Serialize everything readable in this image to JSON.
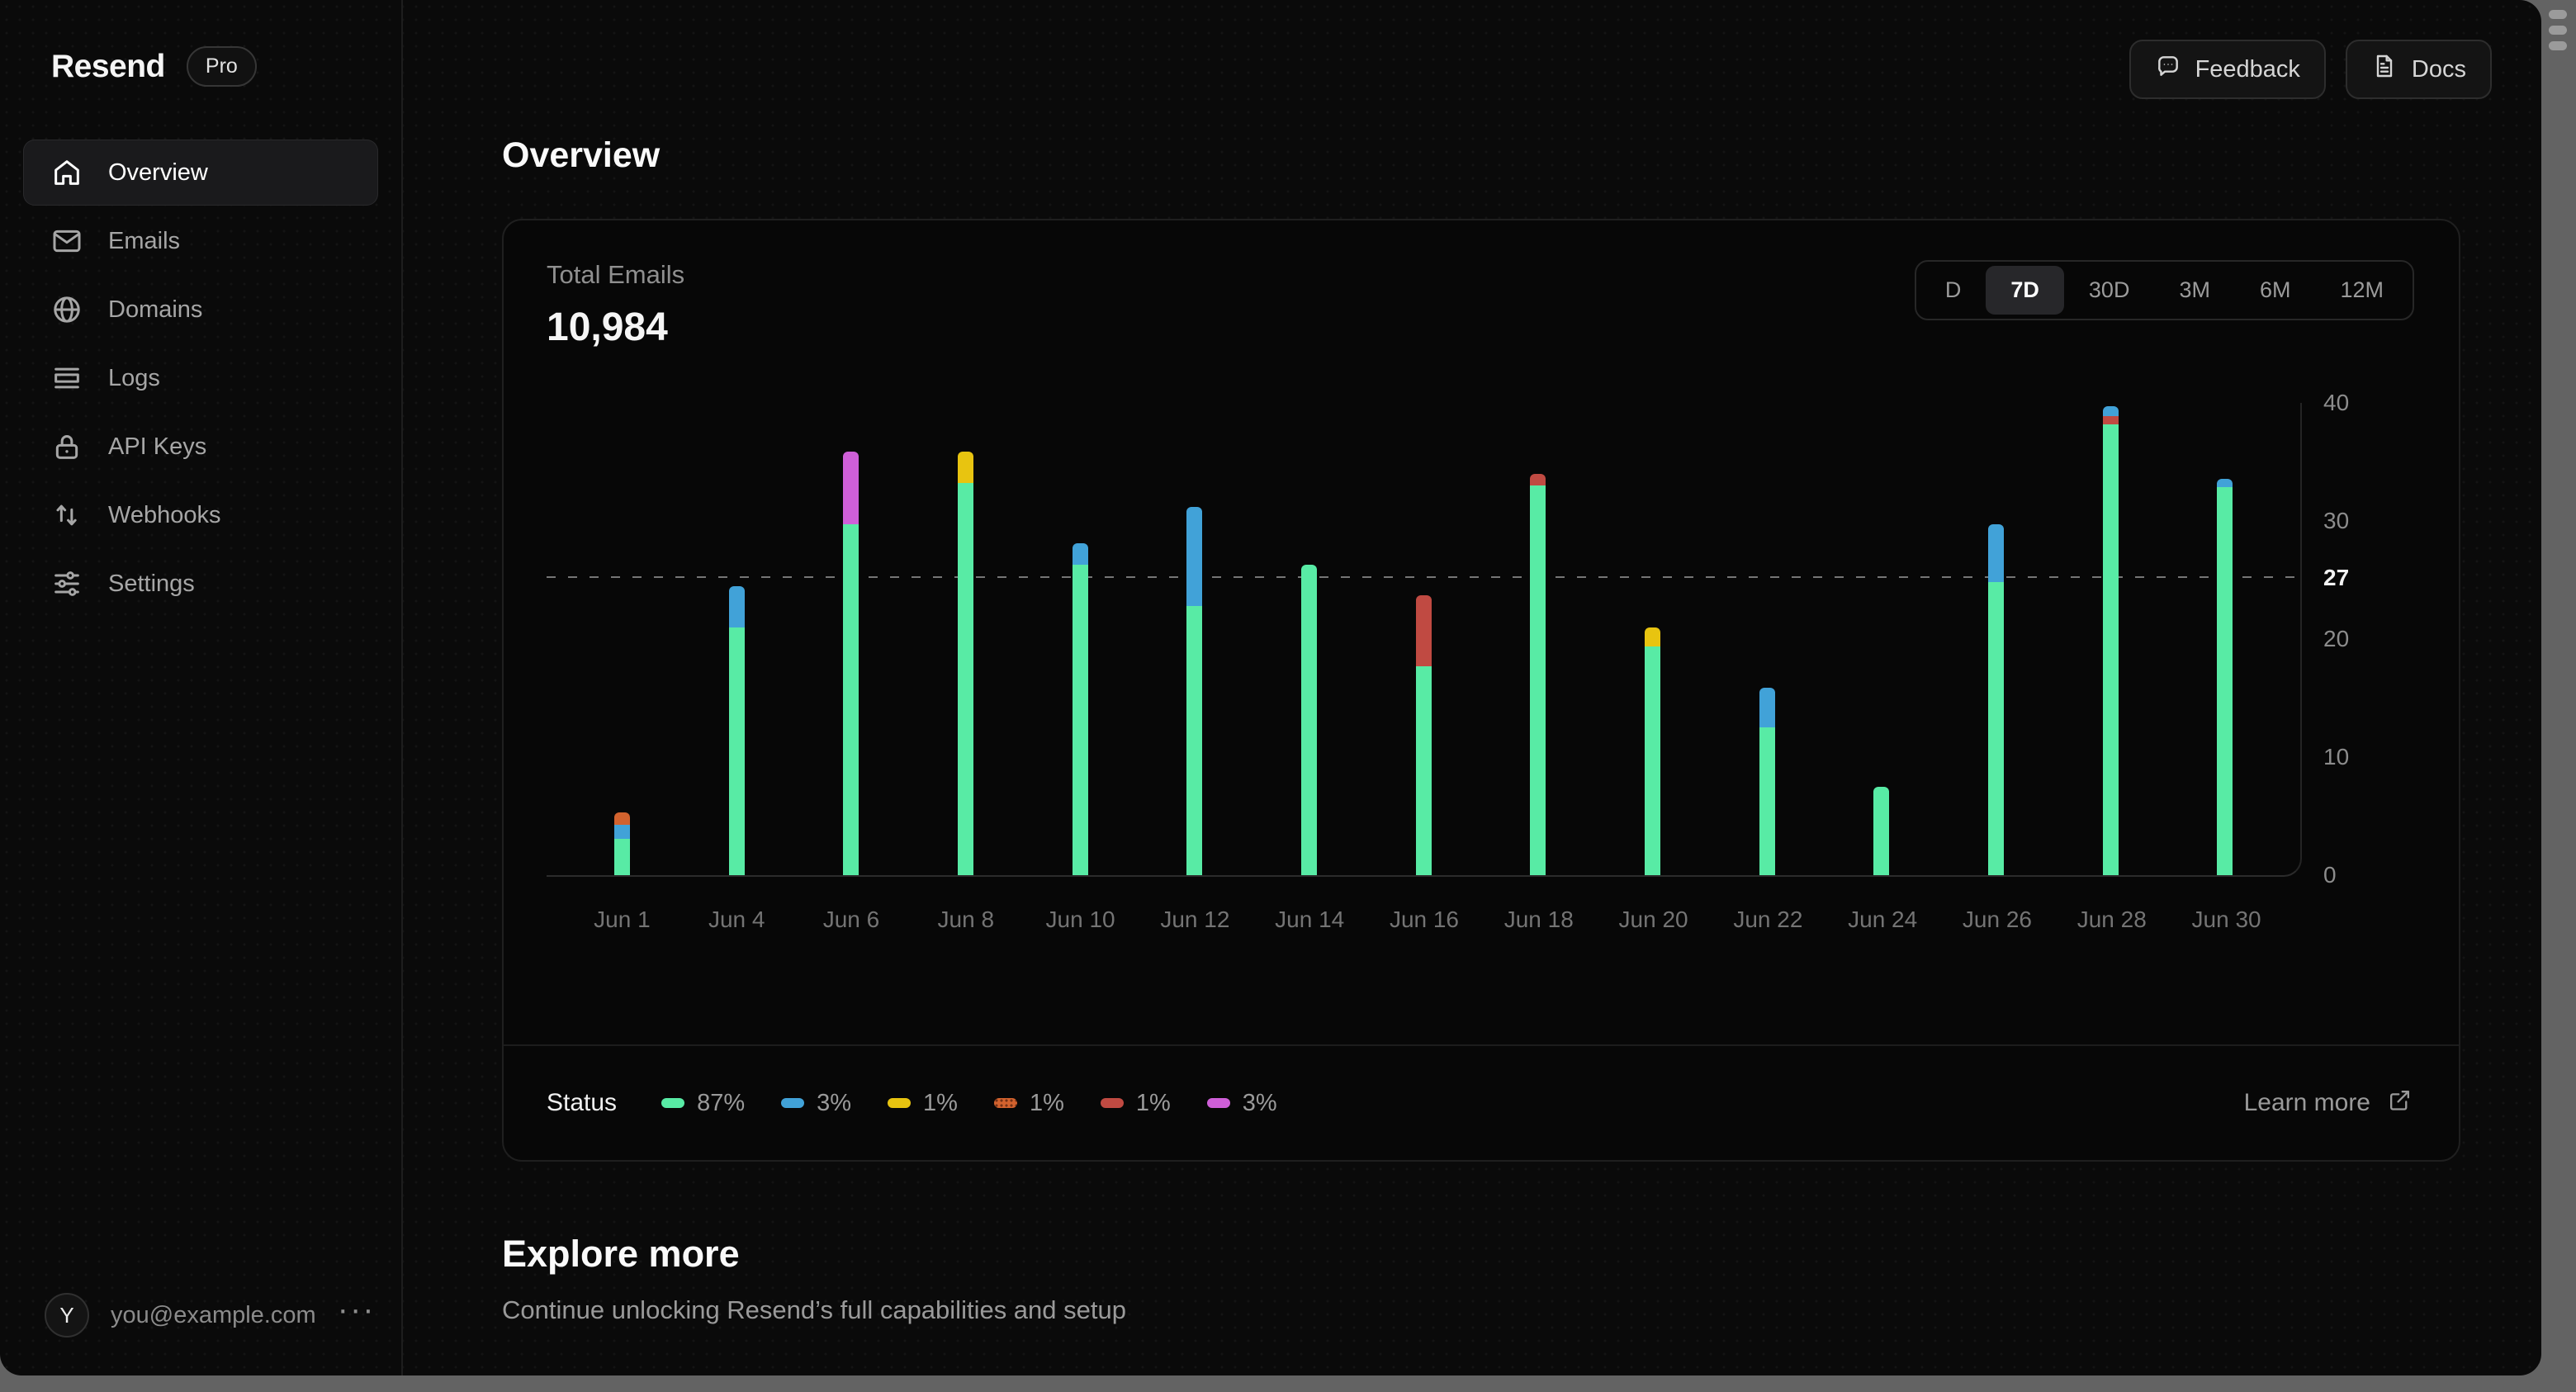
{
  "brand": {
    "name": "Resend",
    "plan_badge": "Pro"
  },
  "sidebar": {
    "items": [
      {
        "label": "Overview",
        "icon": "home-icon",
        "active": true
      },
      {
        "label": "Emails",
        "icon": "mail-icon",
        "active": false
      },
      {
        "label": "Domains",
        "icon": "globe-icon",
        "active": false
      },
      {
        "label": "Logs",
        "icon": "logs-icon",
        "active": false
      },
      {
        "label": "API Keys",
        "icon": "lock-icon",
        "active": false
      },
      {
        "label": "Webhooks",
        "icon": "arrows-up-down-icon",
        "active": false
      },
      {
        "label": "Settings",
        "icon": "sliders-icon",
        "active": false
      }
    ],
    "user": {
      "avatar_initial": "Y",
      "email": "you@example.com",
      "menu_glyph": "···"
    }
  },
  "topbar": {
    "feedback_label": "Feedback",
    "docs_label": "Docs"
  },
  "page": {
    "title": "Overview"
  },
  "metric": {
    "label": "Total Emails",
    "value": "10,984"
  },
  "range_selector": {
    "options": [
      "D",
      "7D",
      "30D",
      "3M",
      "6M",
      "12M"
    ],
    "selected": "7D"
  },
  "card_footer": {
    "status_label": "Status",
    "learn_more_label": "Learn more"
  },
  "explore": {
    "title": "Explore more",
    "subtitle": "Continue unlocking Resend’s full capabilities and setup"
  },
  "chart_data": {
    "type": "bar",
    "stacked": true,
    "ylim": [
      0,
      40
    ],
    "y_ticks": [
      0,
      10,
      20,
      30,
      40
    ],
    "grid": "off",
    "legend_position": "bottom-left",
    "reference_line": {
      "label": "27",
      "value": 27,
      "position_pct": 63
    },
    "statuses": [
      {
        "key": "green",
        "color": "#58EBA5",
        "percent": "87%"
      },
      {
        "key": "blue",
        "color": "#41A2D8",
        "percent": "3%"
      },
      {
        "key": "yellow",
        "color": "#E8C410",
        "percent": "1%"
      },
      {
        "key": "orange",
        "color": "#D2622E",
        "percent": "1%",
        "pattern": "dotted"
      },
      {
        "key": "red",
        "color": "#C04A42",
        "percent": "1%"
      },
      {
        "key": "magenta",
        "color": "#CF5FD8",
        "percent": "3%"
      }
    ],
    "bars": [
      {
        "label": "Jun 1",
        "segments": [
          {
            "status": "green",
            "value": 3.1
          },
          {
            "status": "blue",
            "value": 1.2
          },
          {
            "status": "orange",
            "value": 1.0
          }
        ]
      },
      {
        "label": "Jun 4",
        "segments": [
          {
            "status": "green",
            "value": 21.0
          },
          {
            "status": "blue",
            "value": 3.5
          }
        ]
      },
      {
        "label": "Jun 6",
        "segments": [
          {
            "status": "green",
            "value": 29.7
          },
          {
            "status": "magenta",
            "value": 6.2
          }
        ]
      },
      {
        "label": "Jun 8",
        "segments": [
          {
            "status": "green",
            "value": 33.2
          },
          {
            "status": "yellow",
            "value": 2.7
          }
        ]
      },
      {
        "label": "Jun 10",
        "segments": [
          {
            "status": "green",
            "value": 26.3
          },
          {
            "status": "blue",
            "value": 1.8
          }
        ]
      },
      {
        "label": "Jun 12",
        "segments": [
          {
            "status": "green",
            "value": 22.8
          },
          {
            "status": "blue",
            "value": 8.4
          }
        ]
      },
      {
        "label": "Jun 14",
        "segments": [
          {
            "status": "green",
            "value": 26.3
          }
        ]
      },
      {
        "label": "Jun 16",
        "segments": [
          {
            "status": "green",
            "value": 17.7
          },
          {
            "status": "red",
            "value": 6.0
          }
        ]
      },
      {
        "label": "Jun 18",
        "segments": [
          {
            "status": "green",
            "value": 33.0
          },
          {
            "status": "red",
            "value": 1.0
          }
        ]
      },
      {
        "label": "Jun 20",
        "segments": [
          {
            "status": "green",
            "value": 19.4
          },
          {
            "status": "yellow",
            "value": 1.6
          }
        ]
      },
      {
        "label": "Jun 22",
        "segments": [
          {
            "status": "green",
            "value": 12.5
          },
          {
            "status": "blue",
            "value": 3.4
          }
        ]
      },
      {
        "label": "Jun 24",
        "segments": [
          {
            "status": "green",
            "value": 7.5
          }
        ]
      },
      {
        "label": "Jun 26",
        "segments": [
          {
            "status": "green",
            "value": 24.8
          },
          {
            "status": "blue",
            "value": 4.9
          }
        ]
      },
      {
        "label": "Jun 28",
        "segments": [
          {
            "status": "green",
            "value": 38.2
          },
          {
            "status": "red",
            "value": 0.7
          },
          {
            "status": "blue",
            "value": 0.8
          }
        ]
      },
      {
        "label": "Jun 30",
        "segments": [
          {
            "status": "green",
            "value": 32.9
          },
          {
            "status": "blue",
            "value": 0.7
          }
        ]
      }
    ]
  }
}
